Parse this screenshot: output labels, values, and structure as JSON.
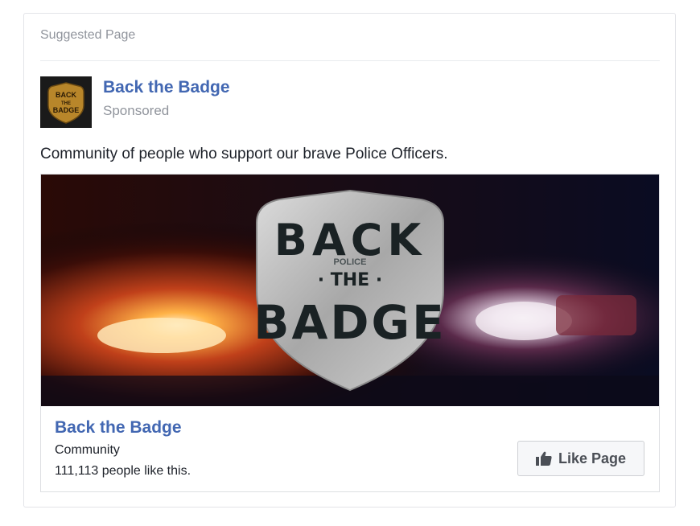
{
  "card": {
    "header_label": "Suggested Page"
  },
  "page": {
    "name": "Back the Badge",
    "sponsored_label": "Sponsored"
  },
  "post": {
    "text": "Community of people who support our brave Police Officers."
  },
  "banner": {
    "badge_top": "BACK",
    "badge_middle": "· THE ·",
    "badge_bottom": "BADGE",
    "badge_small": "POLICE"
  },
  "avatar": {
    "badge_line1": "BACK",
    "badge_line2": "THE",
    "badge_line3": "BADGE"
  },
  "ad": {
    "title": "Back the Badge",
    "category": "Community",
    "likes_text": "111,113 people like this.",
    "like_button_label": "Like Page"
  },
  "colors": {
    "link_blue": "#4267b2",
    "muted_gray": "#90949c",
    "text_dark": "#1d2129"
  },
  "icons": {
    "like_button_icon": "thumbs-up-icon"
  }
}
